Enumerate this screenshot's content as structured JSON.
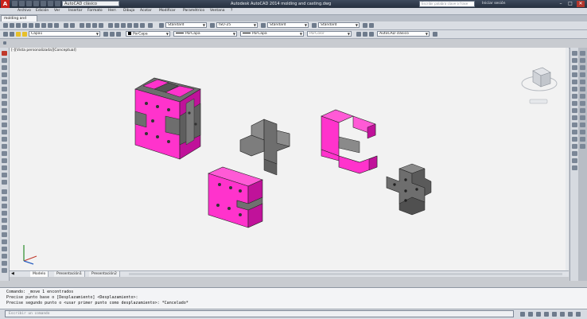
{
  "window": {
    "app_title": "Autodesk AutoCAD 2014   molding and casting.dwg",
    "logo_letter": "A",
    "workspace": "AutoCAD clásico",
    "search_placeholder": "Escribir palabra clave o frase",
    "sign_in": "Iniciar sesión",
    "controls": {
      "minimize": "–",
      "maximize": "□",
      "close": "✕"
    }
  },
  "menu": [
    "Archivo",
    "Edición",
    "Ver",
    "Insertar",
    "Formato",
    "Herr.",
    "Dibujo",
    "Acotar",
    "Modificar",
    "Paramétrico",
    "Ventana",
    "?"
  ],
  "document_tab": "molding and casting*",
  "toolbars": {
    "text_style": "Standard",
    "dim_style": "ISO-25",
    "table_style": "Standard",
    "mleader_style": "Standard",
    "layer": "Capa1",
    "color": "PorCapa",
    "linetype": "PorCapa",
    "lineweight": "PorCapa",
    "plot_style": "PorColor",
    "workspace2": "AutoCAD clásico"
  },
  "viewport": {
    "label": "[-][Vista personalizada][Conceptual]",
    "viewcube_icon": "viewcube-icon",
    "ucs_icon": "ucs-icon"
  },
  "layout_tabs": [
    "Modelo",
    "Presentación1",
    "Presentación2"
  ],
  "command": {
    "history": [
      "Comando: _move 1 encontrados",
      "Precise punto base o [Desplazamiento] <Desplazamiento>:",
      "Precise segundo punto o <usar primer punto como desplazamiento>: *Cancelado*"
    ],
    "placeholder": "Escribir un comando"
  },
  "colors": {
    "mold": "#ff33cc",
    "mold_dark": "#c0129a",
    "part": "#707070",
    "canvas": "#f2f2f2",
    "titlebar": "#2c3645"
  }
}
